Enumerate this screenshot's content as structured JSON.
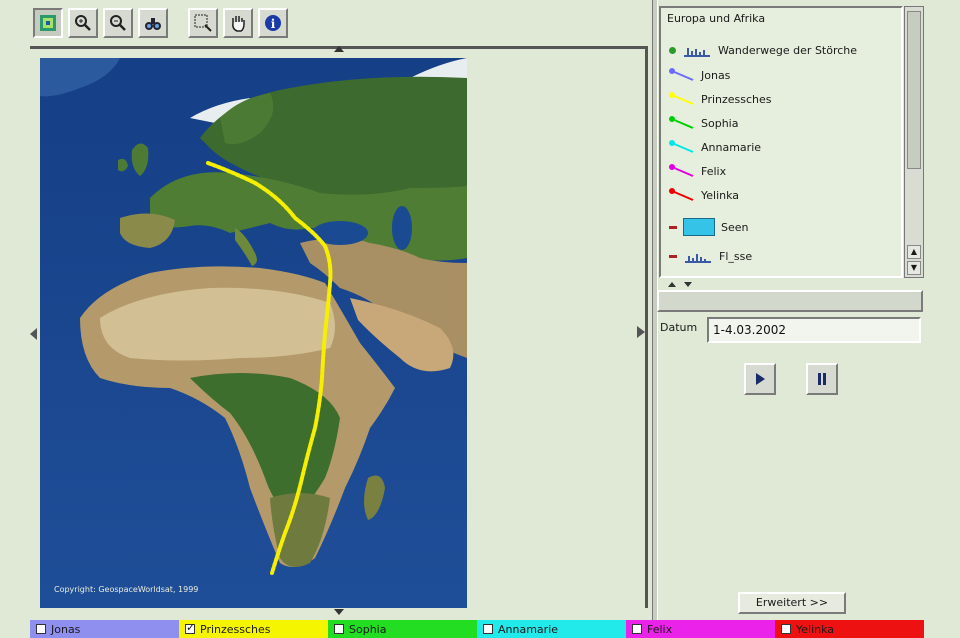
{
  "toolbar": {
    "tools": [
      {
        "name": "overview-icon"
      },
      {
        "name": "zoom-in-icon"
      },
      {
        "name": "zoom-out-icon"
      },
      {
        "name": "pan-icon"
      },
      {
        "name": "zoom-rect-icon"
      },
      {
        "name": "hand-icon"
      },
      {
        "name": "info-icon"
      }
    ]
  },
  "map": {
    "copyright": "Copyright: GeospaceWorldsat, 1999"
  },
  "legend": {
    "title": "Europa und Afrika",
    "layer_label": "Wanderwege der Störche",
    "birds": [
      {
        "name": "Jonas",
        "color": "#6b6bff"
      },
      {
        "name": "Prinzessches",
        "color": "#ffff00"
      },
      {
        "name": "Sophia",
        "color": "#00d000"
      },
      {
        "name": "Annamarie",
        "color": "#00e8e8"
      },
      {
        "name": "Felix",
        "color": "#e000e0"
      },
      {
        "name": "Yelinka",
        "color": "#ee0000"
      }
    ],
    "seen_label": "Seen",
    "flüsse_label": "Fl_sse"
  },
  "datum": {
    "label": "Datum",
    "value": "1-4.03.2002"
  },
  "expand_button": "Erweitert >>",
  "bottom_bar": [
    {
      "label": "Jonas",
      "color": "#8f8ff0",
      "checked": false
    },
    {
      "label": "Prinzessches",
      "color": "#f5f500",
      "checked": true
    },
    {
      "label": "Sophia",
      "color": "#22dd22",
      "checked": false
    },
    {
      "label": "Annamarie",
      "color": "#22eaea",
      "checked": false
    },
    {
      "label": "Felix",
      "color": "#ea22ea",
      "checked": false
    },
    {
      "label": "Yelinka",
      "color": "#ee1111",
      "checked": false
    }
  ]
}
